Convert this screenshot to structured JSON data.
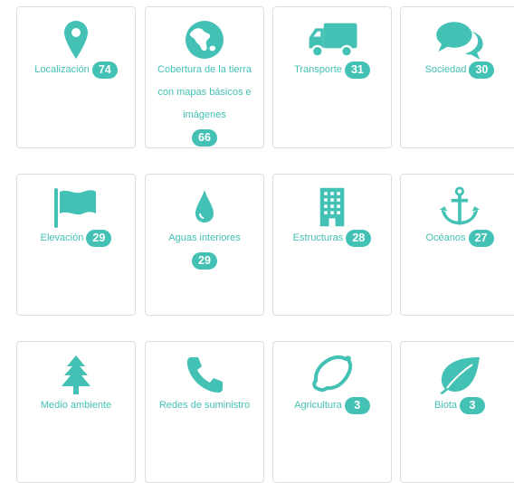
{
  "categories": [
    {
      "label": "Localización",
      "count": "74",
      "icon": "map-pin-icon"
    },
    {
      "label": "Cobertura de la tierra con mapas básicos e imágenes",
      "count": "66",
      "icon": "globe-icon"
    },
    {
      "label": "Transporte",
      "count": "31",
      "icon": "truck-icon"
    },
    {
      "label": "Sociedad",
      "count": "30",
      "icon": "chat-bubbles-icon"
    },
    {
      "label": "Elevación",
      "count": "29",
      "icon": "flag-icon"
    },
    {
      "label": "Aguas interiores",
      "count": "29",
      "icon": "water-drop-icon"
    },
    {
      "label": "Estructuras",
      "count": "28",
      "icon": "building-icon"
    },
    {
      "label": "Océanos",
      "count": "27",
      "icon": "anchor-icon"
    },
    {
      "label": "Medio ambiente",
      "count": "",
      "icon": "tree-icon"
    },
    {
      "label": "Redes de suministro",
      "count": "",
      "icon": "phone-icon"
    },
    {
      "label": "Agricultura",
      "count": "3",
      "icon": "lemon-icon"
    },
    {
      "label": "Biota",
      "count": "3",
      "icon": "leaf-icon"
    }
  ],
  "colors": {
    "accent": "#43c1b4",
    "border": "#dedede",
    "background": "#ffffff"
  }
}
